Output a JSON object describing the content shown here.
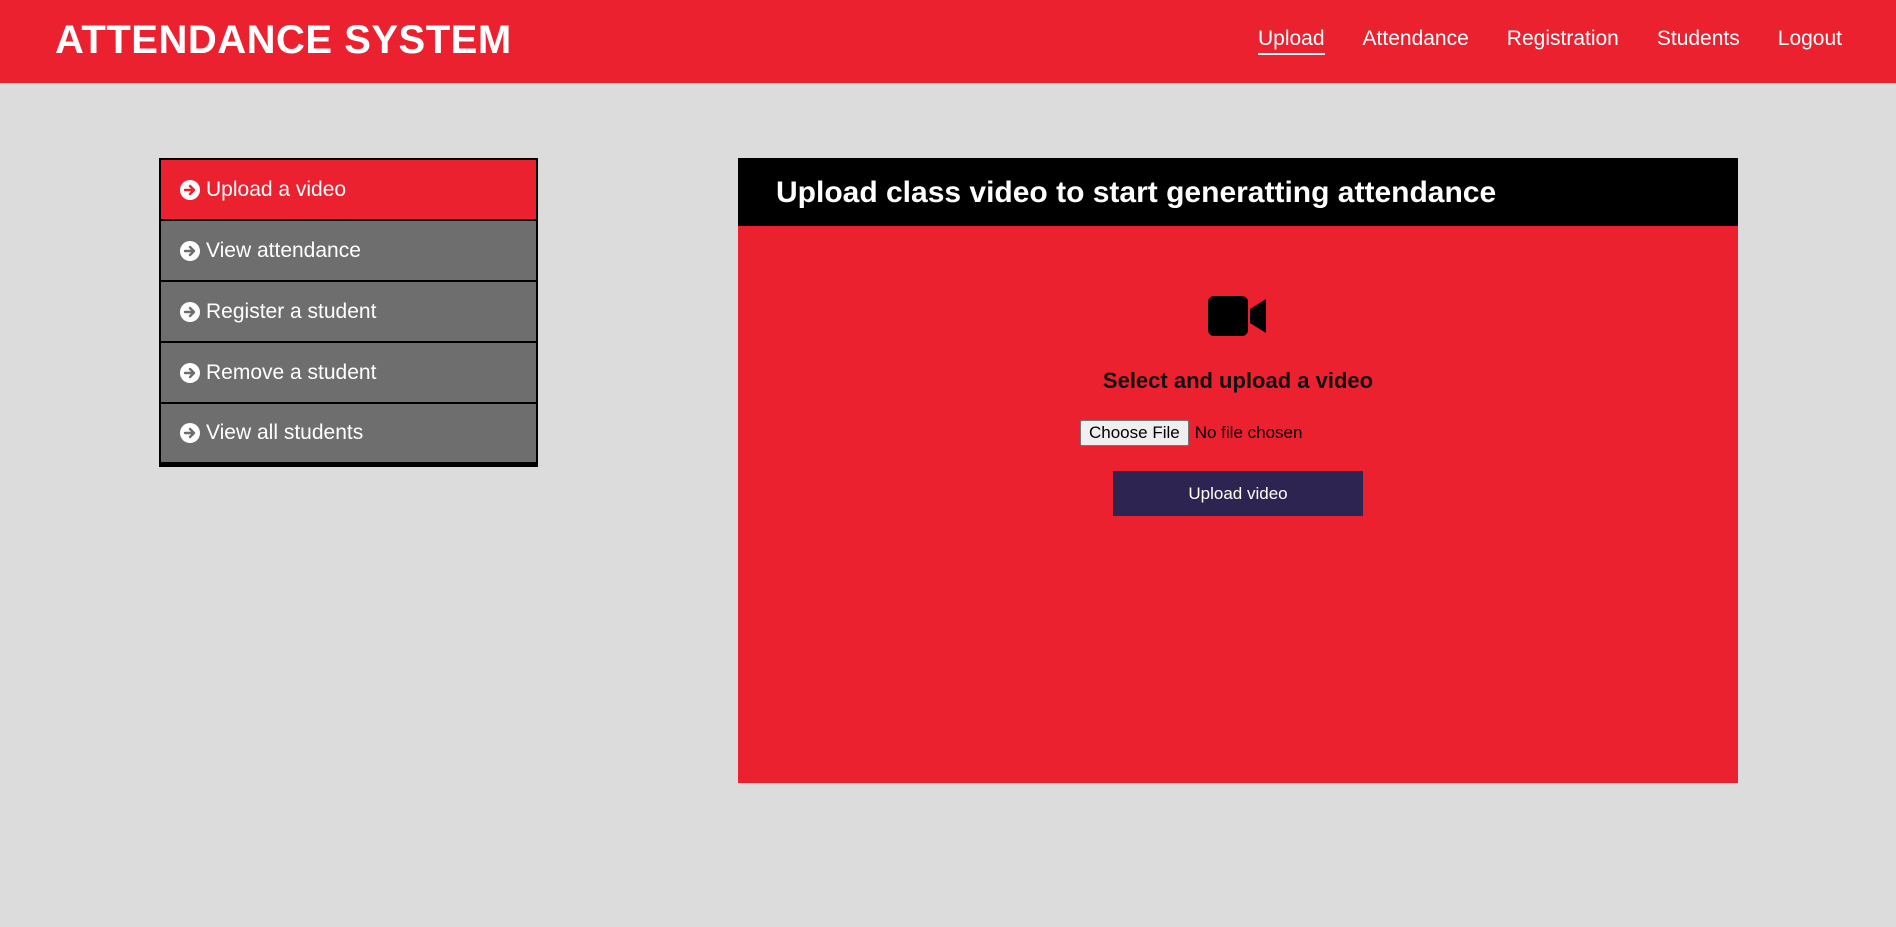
{
  "header": {
    "brand": "ATTENDANCE SYSTEM",
    "nav": [
      {
        "label": "Upload",
        "active": true
      },
      {
        "label": "Attendance"
      },
      {
        "label": "Registration"
      },
      {
        "label": "Students"
      },
      {
        "label": "Logout"
      }
    ]
  },
  "sidebar": {
    "items": [
      {
        "label": "Upload a video",
        "icon": "arrow-circle-right-icon",
        "active": true
      },
      {
        "label": "View attendance",
        "icon": "arrow-circle-right-icon"
      },
      {
        "label": "Register a student",
        "icon": "arrow-circle-right-icon"
      },
      {
        "label": "Remove a student",
        "icon": "arrow-circle-right-icon"
      },
      {
        "label": "View all students",
        "icon": "arrow-circle-right-icon"
      }
    ]
  },
  "panel": {
    "title": "Upload class video to start generatting attendance",
    "icon": "video-camera-icon",
    "subtitle": "Select and upload a video",
    "file_button_label": "Choose File",
    "file_status": "No file chosen",
    "upload_button_label": "Upload video"
  },
  "colors": {
    "primary_red": "#ec2130",
    "header_black": "#000000",
    "menu_gray": "#6e6e6e",
    "upload_button": "#2d2451",
    "background": "#dcdcdc"
  }
}
